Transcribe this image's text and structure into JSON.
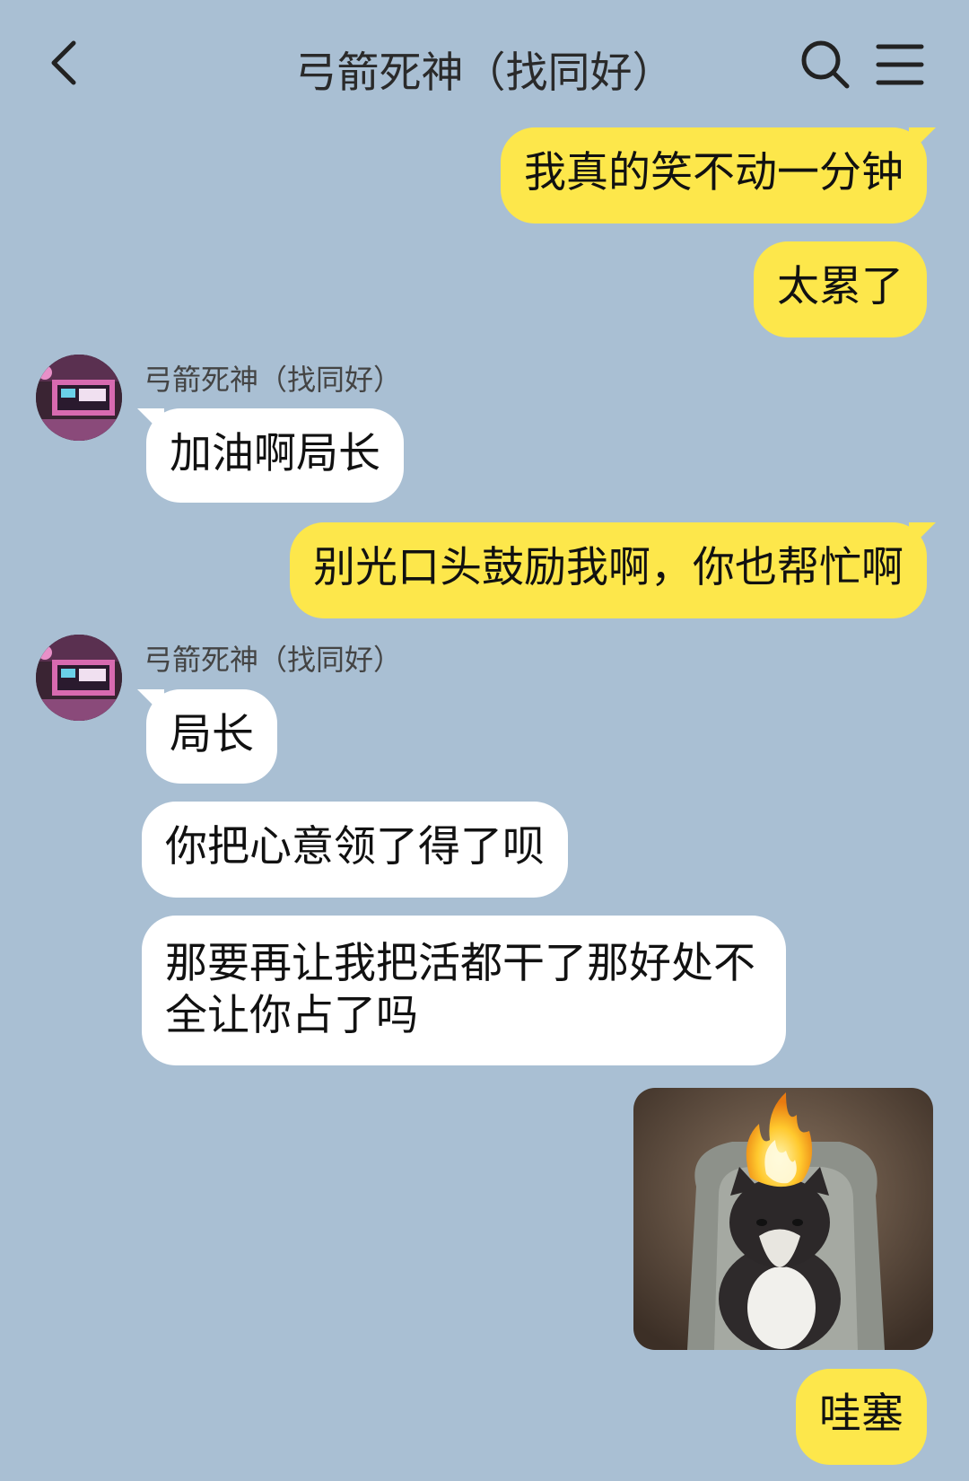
{
  "header": {
    "title": "弓箭死神（找同好）",
    "back_icon": "chevron-left-icon",
    "search_icon": "search-icon",
    "menu_icon": "hamburger-menu-icon"
  },
  "messages": [
    {
      "side": "out",
      "text": "我真的笑不动一分钟"
    },
    {
      "side": "out",
      "text": "太累了"
    },
    {
      "side": "in",
      "sender": "弓箭死神（找同好）",
      "text": "加油啊局长"
    },
    {
      "side": "out",
      "text": "别光口头鼓励我啊，你也帮忙啊"
    },
    {
      "side": "in",
      "sender": "弓箭死神（找同好）",
      "text": "局长"
    },
    {
      "side": "in",
      "text": "你把心意领了得了呗"
    },
    {
      "side": "in",
      "text": "那要再让我把活都干了那好处不全让你占了吗"
    },
    {
      "side": "out",
      "type": "sticker",
      "description_icon": "burning-cat-sticker"
    },
    {
      "side": "out",
      "text": "哇塞"
    }
  ],
  "colors": {
    "background": "#a9bfd3",
    "outgoing_bubble": "#fde74b",
    "incoming_bubble": "#ffffff"
  }
}
